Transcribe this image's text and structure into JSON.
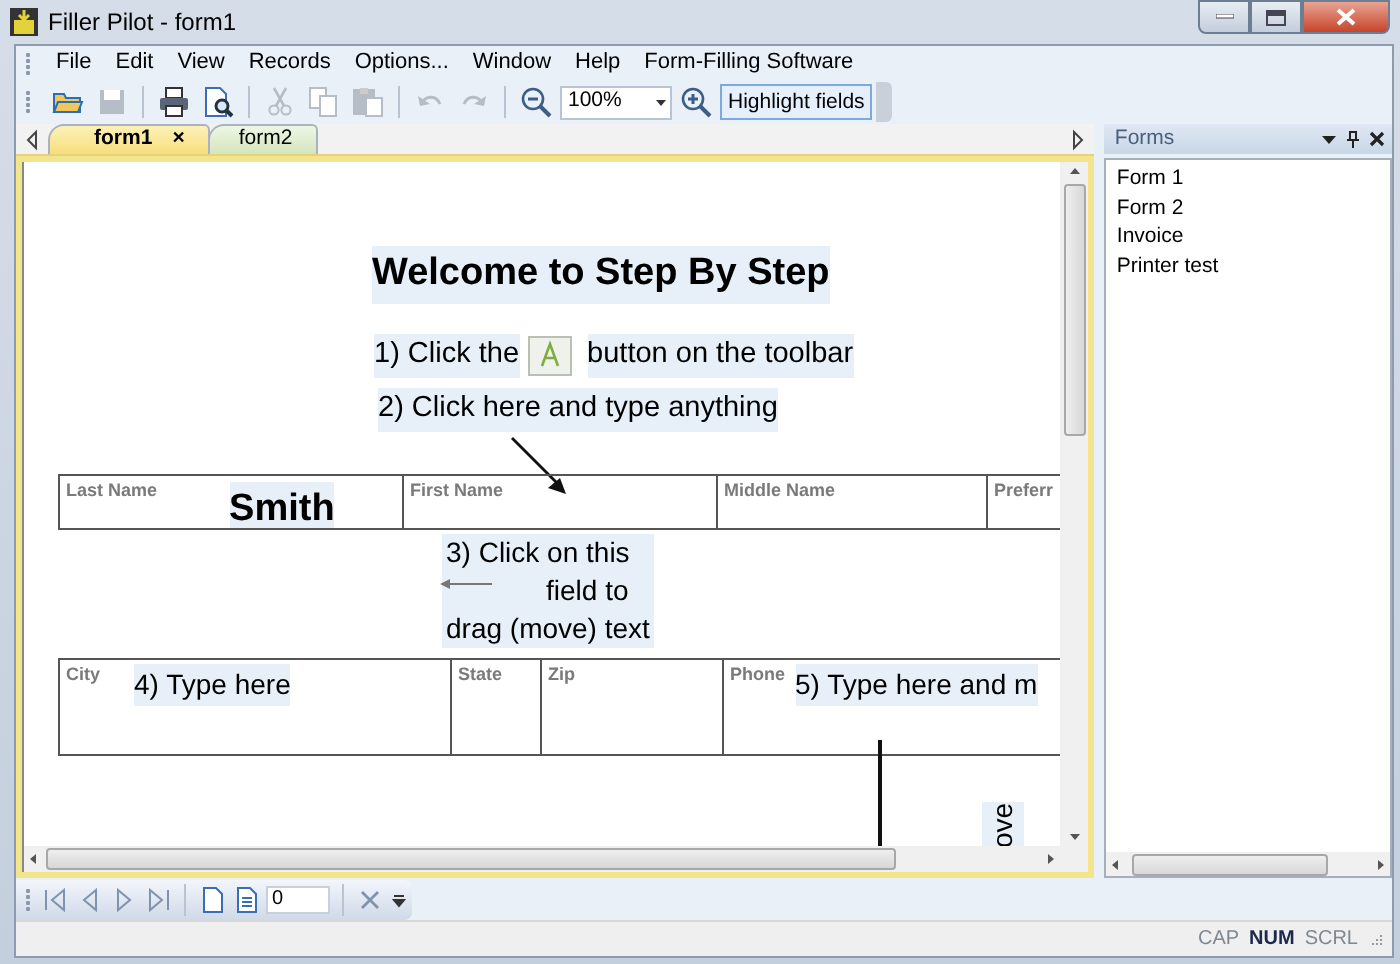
{
  "window": {
    "title": "Filler Pilot - form1"
  },
  "menu": [
    "File",
    "Edit",
    "View",
    "Records",
    "Options...",
    "Window",
    "Help",
    "Form-Filling Software"
  ],
  "toolbar": {
    "buttons": [
      {
        "kind": "open",
        "disabled": false
      },
      {
        "kind": "save",
        "disabled": true
      },
      {
        "kind": "print",
        "disabled": false
      },
      {
        "kind": "preview",
        "disabled": false
      },
      {
        "kind": "cut",
        "disabled": true
      },
      {
        "kind": "copy",
        "disabled": true
      },
      {
        "kind": "paste",
        "disabled": true
      },
      {
        "kind": "undo",
        "disabled": true
      },
      {
        "kind": "redo",
        "disabled": true
      },
      {
        "kind": "zoomout",
        "disabled": false
      },
      {
        "kind": "zoom",
        "value": "100%"
      },
      {
        "kind": "zoomin",
        "disabled": false
      },
      {
        "kind": "toggle",
        "label": "Highlight fields",
        "selected": true
      }
    ]
  },
  "tabs": [
    {
      "label": "form1",
      "selected": true,
      "close": "×"
    },
    {
      "label": "form2",
      "selected": false
    }
  ],
  "document": {
    "title": "Welcome to Step By Step",
    "step1": [
      "1) Click the",
      "button on the toolbar"
    ],
    "step2": "2) Click here and type anything",
    "row1": [
      {
        "label": "Last Name",
        "value": "Smith"
      },
      {
        "label": "First Name"
      },
      {
        "label": "Middle Name"
      },
      {
        "label": "Preferr"
      }
    ],
    "step3": [
      "3) Click on this",
      "field to",
      "drag (move) text"
    ],
    "row2": [
      {
        "label": "City",
        "value": "4) Type here"
      },
      {
        "label": "State"
      },
      {
        "label": "Zip"
      },
      {
        "label": "Phone",
        "value": "5) Type here and m"
      }
    ],
    "rotated_text": "ove"
  },
  "forms_panel": {
    "title": "Forms",
    "items": [
      "Form 1",
      "Form 2",
      "Invoice",
      "Printer test"
    ]
  },
  "navigator": {
    "record": "0"
  },
  "status_bar": [
    {
      "label": "CAP",
      "on": false
    },
    {
      "label": "NUM",
      "on": true
    },
    {
      "label": "SCRL",
      "on": false
    }
  ]
}
